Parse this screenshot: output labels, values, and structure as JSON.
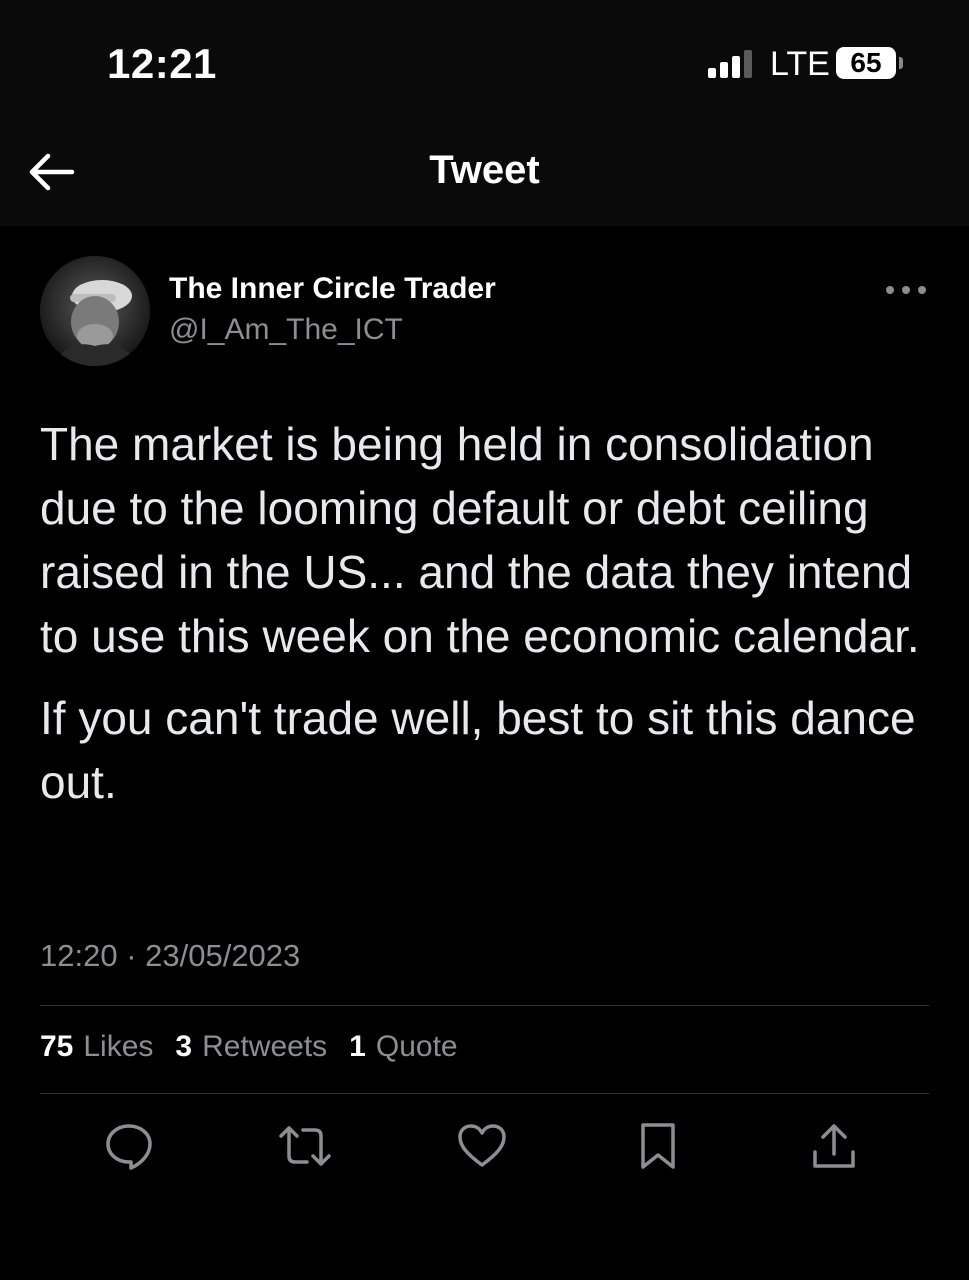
{
  "status_bar": {
    "time": "12:21",
    "network": "LTE",
    "battery": "65"
  },
  "nav": {
    "title": "Tweet",
    "back_icon": "arrow-left-icon"
  },
  "tweet": {
    "author_name": "The Inner Circle Trader",
    "author_handle": "@I_Am_The_ICT",
    "paragraphs": [
      "The market is being held in consolidation due to the looming default or debt ceiling raised in the US... and the data they intend to use this week on the economic calendar.",
      "If you can't trade well, best to sit this dance out."
    ],
    "timestamp": "12:20 · 23/05/2023",
    "stats": {
      "likes_count": "75",
      "likes_label": "Likes",
      "retweets_count": "3",
      "retweets_label": "Retweets",
      "quotes_count": "1",
      "quotes_label": "Quote"
    }
  },
  "actions": [
    "reply-icon",
    "retweet-icon",
    "like-icon",
    "bookmark-icon",
    "share-icon"
  ],
  "colors": {
    "background": "#000000",
    "primary_text": "#e7e9ea",
    "secondary_text": "#8b8f94",
    "divider": "#2f3336"
  }
}
